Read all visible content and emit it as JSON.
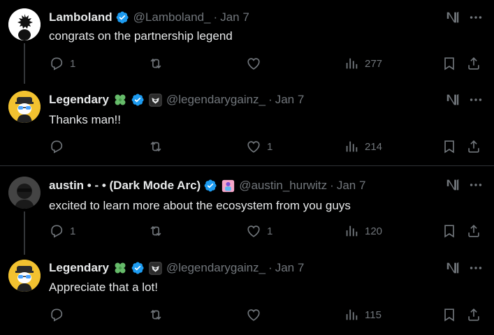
{
  "tweets": [
    {
      "name": "Lamboland",
      "handle": "@Lamboland_",
      "separator": "·",
      "time": "Jan 7",
      "text": "congrats on the partnership legend",
      "replies": "1",
      "retweets": "",
      "likes": "",
      "views": "277"
    },
    {
      "name": "Legendary",
      "handle": "@legendarygainz_",
      "separator": "·",
      "time": "Jan 7",
      "text": "Thanks man!!",
      "replies": "",
      "retweets": "",
      "likes": "1",
      "views": "214"
    },
    {
      "name": "austin • - • (Dark Mode Arc)",
      "handle": "@austin_hurwitz",
      "separator": "·",
      "time": "Jan 7",
      "text": "excited to learn more about the ecosystem from you guys",
      "replies": "1",
      "retweets": "",
      "likes": "1",
      "views": "120"
    },
    {
      "name": "Legendary",
      "handle": "@legendarygainz_",
      "separator": "·",
      "time": "Jan 7",
      "text": "Appreciate that a lot!",
      "replies": "",
      "retweets": "",
      "likes": "",
      "views": "115"
    }
  ],
  "icons": {
    "verified": "verified-badge-icon",
    "clover": "clover-emoji-icon",
    "affiliate": "affiliate-badge-icon",
    "grok": "grok-icon",
    "more": "more-icon",
    "reply": "reply-icon",
    "retweet": "retweet-icon",
    "like": "like-icon",
    "views": "views-icon",
    "bookmark": "bookmark-icon",
    "share": "share-icon"
  },
  "colors": {
    "background": "#000000",
    "text": "#e7e9ea",
    "muted": "#71767b",
    "verified": "#1d9bf0",
    "divider": "#2f3336"
  }
}
